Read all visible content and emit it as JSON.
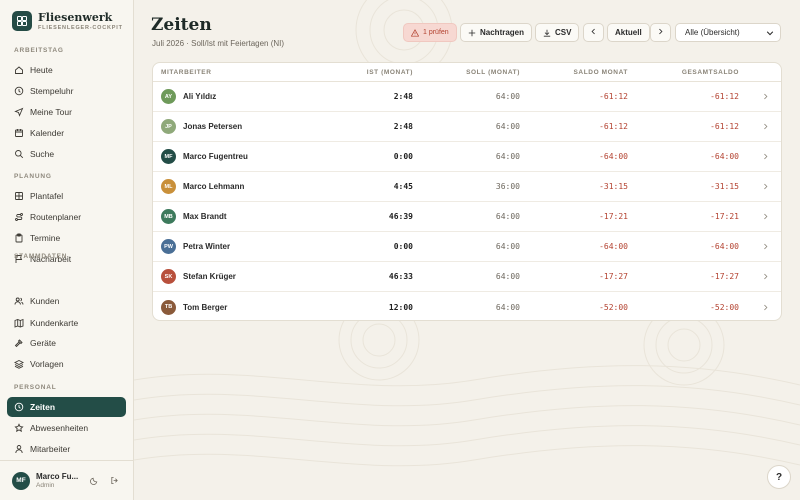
{
  "brand": {
    "name": "Fliesenwerk",
    "subtitle": "FLIESENLEGER-COCKPIT"
  },
  "sidebar": {
    "sections": [
      {
        "label": "ARBEITSTAG",
        "items": [
          {
            "label": "Heute",
            "icon": "home-icon"
          },
          {
            "label": "Stempeluhr",
            "icon": "clock-icon"
          },
          {
            "label": "Meine Tour",
            "icon": "navigation-icon"
          },
          {
            "label": "Kalender",
            "icon": "calendar-icon"
          },
          {
            "label": "Suche",
            "icon": "search-icon"
          }
        ]
      },
      {
        "label": "PLANUNG",
        "items": [
          {
            "label": "Plantafel",
            "icon": "grid-icon"
          },
          {
            "label": "Routenplaner",
            "icon": "route-icon"
          },
          {
            "label": "Termine",
            "icon": "clipboard-icon"
          },
          {
            "label": "Nacharbeit",
            "icon": "flag-icon"
          }
        ]
      },
      {
        "label": "STAMMDATEN",
        "items": [
          {
            "label": "Kunden",
            "icon": "users-icon"
          },
          {
            "label": "Kundenkarte",
            "icon": "map-icon"
          },
          {
            "label": "Geräte",
            "icon": "hammer-icon"
          },
          {
            "label": "Vorlagen",
            "icon": "layers-icon"
          }
        ]
      },
      {
        "label": "PERSONAL",
        "items": [
          {
            "label": "Zeiten",
            "icon": "clock-icon",
            "active": true
          },
          {
            "label": "Abwesenheiten",
            "icon": "star-icon"
          },
          {
            "label": "Mitarbeiter",
            "icon": "user-icon"
          }
        ]
      }
    ],
    "user": {
      "initials": "MF",
      "name": "Marco Fu...",
      "role": "Admin"
    }
  },
  "page": {
    "title": "Zeiten",
    "subtitle": "Juli 2026 · Soll/Ist mit Feiertagen (NI)"
  },
  "toolbar": {
    "warn_label": "1 prüfen",
    "add_label": "Nachtragen",
    "csv_label": "CSV",
    "current_label": "Aktuell",
    "filter_value": "Alle (Übersicht)"
  },
  "table": {
    "headers": {
      "name": "MITARBEITER",
      "ist": "IST (MONAT)",
      "soll": "SOLL (MONAT)",
      "saldo": "SALDO MONAT",
      "gesamt": "GESAMTSALDO"
    },
    "rows": [
      {
        "initials": "AY",
        "color": "#6e9a5a",
        "name": "Ali Yıldız",
        "ist": "2:48",
        "soll": "64:00",
        "saldo": "-61:12",
        "gesamt": "-61:12"
      },
      {
        "initials": "JP",
        "color": "#8fa97a",
        "name": "Jonas Petersen",
        "ist": "2:48",
        "soll": "64:00",
        "saldo": "-61:12",
        "gesamt": "-61:12"
      },
      {
        "initials": "MF",
        "color": "#234d47",
        "name": "Marco Fugentreu",
        "ist": "0:00",
        "soll": "64:00",
        "saldo": "-64:00",
        "gesamt": "-64:00"
      },
      {
        "initials": "ML",
        "color": "#c9903a",
        "name": "Marco Lehmann",
        "ist": "4:45",
        "soll": "36:00",
        "saldo": "-31:15",
        "gesamt": "-31:15"
      },
      {
        "initials": "MB",
        "color": "#3d7a5c",
        "name": "Max Brandt",
        "ist": "46:39",
        "soll": "64:00",
        "saldo": "-17:21",
        "gesamt": "-17:21"
      },
      {
        "initials": "PW",
        "color": "#4a6f96",
        "name": "Petra Winter",
        "ist": "0:00",
        "soll": "64:00",
        "saldo": "-64:00",
        "gesamt": "-64:00"
      },
      {
        "initials": "SK",
        "color": "#b8503c",
        "name": "Stefan Krüger",
        "ist": "46:33",
        "soll": "64:00",
        "saldo": "-17:27",
        "gesamt": "-17:27"
      },
      {
        "initials": "TB",
        "color": "#8a5a3a",
        "name": "Tom Berger",
        "ist": "12:00",
        "soll": "64:00",
        "saldo": "-52:00",
        "gesamt": "-52:00"
      }
    ]
  },
  "help_label": "?"
}
